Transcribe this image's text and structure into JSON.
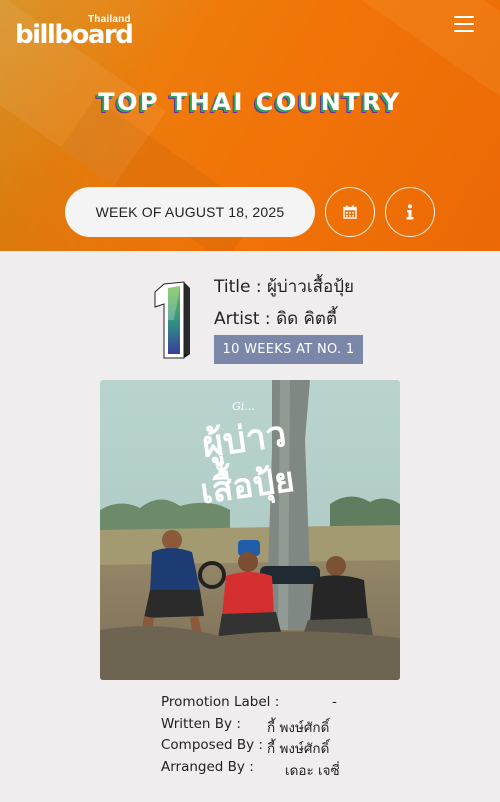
{
  "header": {
    "logo_text": "billboard",
    "logo_country": "Thailand",
    "menu_icon": "hamburger-icon",
    "chart_title": "TOP THAI COUNTRY"
  },
  "week": {
    "label": "WEEK OF AUGUST 18, 2025",
    "calendar_icon": "calendar-icon",
    "info_icon": "info-icon"
  },
  "entry": {
    "rank": "1",
    "title_label": "Title : ",
    "title": "ผู้บ่าวเสื้อปุ้ย",
    "artist_label": "Artist : ",
    "artist": "ดิด คิตตี้",
    "weeks_badge": "10 WEEKS AT NO. 1",
    "cover_text_line1": "ผู้บ่าว",
    "cover_text_line2": "เสื้อปุ้ย",
    "cover_signature": "Gi..."
  },
  "credits": [
    {
      "label": "Promotion Label :",
      "value": "-"
    },
    {
      "label": "Written By :",
      "value": "กี้ พงษ์ศักดิ์"
    },
    {
      "label": "Composed By :",
      "value": "กี้ พงษ์ศักดิ์"
    },
    {
      "label": "Arranged By :",
      "value": "เดอะ เจซี่"
    }
  ],
  "colors": {
    "hero_orange": "#f07208",
    "badge": "#7b87a8",
    "background": "#efeded"
  }
}
